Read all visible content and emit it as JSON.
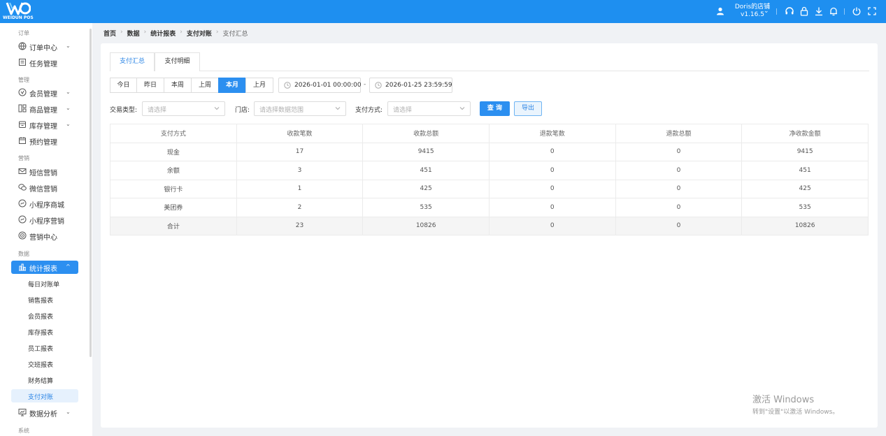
{
  "header": {
    "logo_text": "WEIDUN POS",
    "store_name": "Doris的店铺",
    "version": "v1.16.5",
    "colors": {
      "bar": "#1e8ff0",
      "accent": "#2c8ff0"
    },
    "icons": [
      "user-icon",
      "headset-icon",
      "lock-icon",
      "download-icon",
      "bell-icon",
      "power-icon",
      "fullscreen-icon"
    ]
  },
  "sidebar": {
    "groups": {
      "orders": "订单",
      "management": "管理",
      "marketing": "营销",
      "data": "数据",
      "system": "系统"
    },
    "items": {
      "order_center": "订单中心",
      "task_mgmt": "任务管理",
      "member_mgmt": "会员管理",
      "product_mgmt": "商品管理",
      "inventory_mgmt": "库存管理",
      "booking_mgmt": "预约管理",
      "sms_marketing": "短信营销",
      "wechat_marketing": "微信营销",
      "mini_mall": "小程序商城",
      "mini_marketing": "小程序营销",
      "marketing_center": "营销中心",
      "stats_reports": "统计报表",
      "data_analysis": "数据分析"
    },
    "sub_items": [
      "每日对账单",
      "销售报表",
      "会员报表",
      "库存报表",
      "员工报表",
      "交班报表",
      "财务结算",
      "支付对账"
    ]
  },
  "breadcrumb": [
    "首页",
    "数据",
    "统计报表",
    "支付对账",
    "支付汇总"
  ],
  "tabs": [
    "支付汇总",
    "支付明细"
  ],
  "range_buttons": [
    "今日",
    "昨日",
    "本周",
    "上周",
    "本月",
    "上月"
  ],
  "date_range": {
    "start": "2026-01-01 00:00:00",
    "end": "2026-01-25 23:59:59",
    "separator": "-"
  },
  "filters": {
    "trans_type_label": "交易类型:",
    "trans_type_placeholder": "请选择",
    "store_label": "门店:",
    "store_placeholder": "请选择数据范围",
    "pay_method_label": "支付方式:",
    "pay_method_placeholder": "请选择"
  },
  "buttons": {
    "query": "查 询",
    "export": "导出"
  },
  "table": {
    "columns": [
      "支付方式",
      "收款笔数",
      "收款总额",
      "退款笔数",
      "退款总额",
      "净收款金额"
    ],
    "rows": [
      [
        "现金",
        "17",
        "9415",
        "0",
        "0",
        "9415"
      ],
      [
        "余额",
        "3",
        "451",
        "0",
        "0",
        "451"
      ],
      [
        "银行卡",
        "1",
        "425",
        "0",
        "0",
        "425"
      ],
      [
        "美团券",
        "2",
        "535",
        "0",
        "0",
        "535"
      ],
      [
        "合计",
        "23",
        "10826",
        "0",
        "0",
        "10826"
      ]
    ]
  },
  "watermark": {
    "line1": "激活 Windows",
    "line2": "转到\"设置\"以激活 Windows。"
  }
}
